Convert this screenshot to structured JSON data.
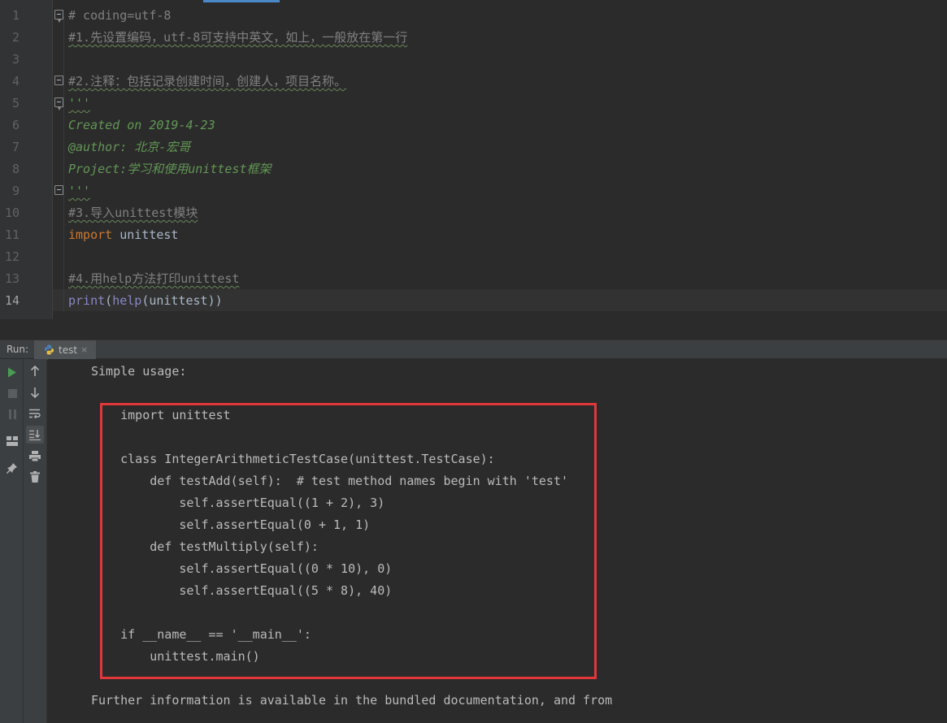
{
  "editor": {
    "line_numbers": [
      "1",
      "2",
      "3",
      "4",
      "5",
      "6",
      "7",
      "8",
      "9",
      "10",
      "11",
      "12",
      "13",
      "14"
    ],
    "current_line": "14",
    "lines": {
      "l1": "# coding=utf-8",
      "l2": "#1.先设置编码，utf-8可支持中英文，如上，一般放在第一行",
      "l4": "#2.注释：包括记录创建时间，创建人，项目名称。",
      "l5": "'''",
      "l6": "Created on 2019-4-23",
      "l7": "@author: 北京-宏哥",
      "l8": "Project:学习和使用unittest框架",
      "l9": "'''",
      "l10": "#3.导入unittest模块",
      "l11_kw": "import",
      "l11_rest": " unittest",
      "l13": "#4.用help方法打印unittest",
      "l14_print": "print",
      "l14_p1": "(",
      "l14_help": "help",
      "l14_rest": "(unittest))"
    }
  },
  "run_panel": {
    "label": "Run:",
    "tab_label": "test",
    "tab_close": "×",
    "icons_left": [
      "run-icon",
      "stop-icon",
      "pause-icon",
      "layout-icon",
      "pin-icon"
    ],
    "icons_right": [
      "up-arrow-icon",
      "down-arrow-icon",
      "soft-wrap-icon",
      "scroll-to-end-icon",
      "print-icon",
      "trash-icon"
    ]
  },
  "console": {
    "lines": [
      "Simple usage:",
      "",
      "    import unittest",
      "",
      "    class IntegerArithmeticTestCase(unittest.TestCase):",
      "        def testAdd(self):  # test method names begin with 'test'",
      "            self.assertEqual((1 + 2), 3)",
      "            self.assertEqual(0 + 1, 1)",
      "        def testMultiply(self):",
      "            self.assertEqual((0 * 10), 0)",
      "            self.assertEqual((5 * 8), 40)",
      "",
      "    if __name__ == '__main__':",
      "        unittest.main()",
      "",
      "Further information is available in the bundled documentation, and from"
    ]
  },
  "colors": {
    "highlight_box": "#e03838",
    "docstring": "#629755",
    "keyword": "#cc7832",
    "builtin": "#8888c6",
    "comment": "#808080"
  }
}
